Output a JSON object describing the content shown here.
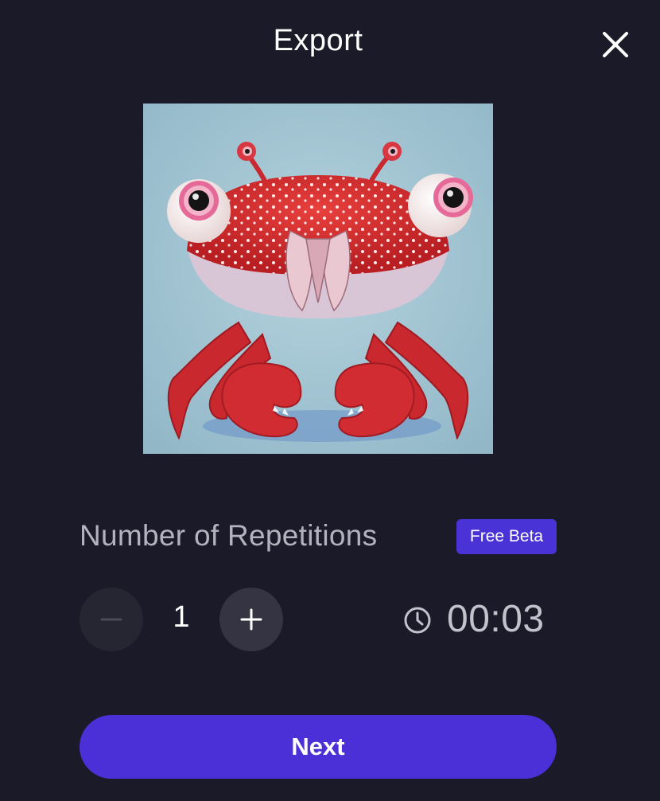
{
  "dialog": {
    "title": "Export",
    "close_icon": "close-icon"
  },
  "preview": {
    "image_description": "3D rendered red spotted crab with large googly eyes on light blue background"
  },
  "repetitions": {
    "label": "Number of Repetitions",
    "badge": "Free Beta",
    "value": "1",
    "decrement_icon": "minus-icon",
    "increment_icon": "plus-icon"
  },
  "duration": {
    "icon": "clock-icon",
    "value": "00:03"
  },
  "actions": {
    "next_label": "Next"
  },
  "colors": {
    "background": "#1a1a28",
    "accent": "#4a30d6",
    "badge": "#4a33d6",
    "muted_text": "#b3b3bf"
  }
}
